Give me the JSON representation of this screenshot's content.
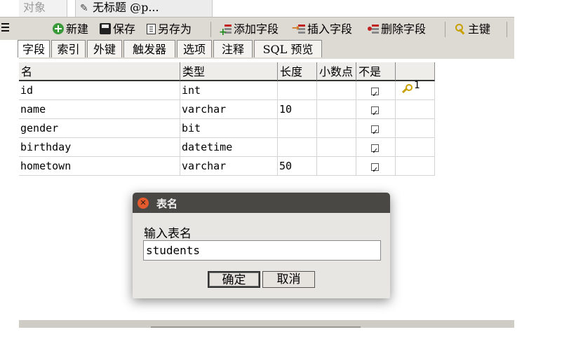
{
  "tabs": {
    "inactive": "对象",
    "active": "无标题 @p..."
  },
  "toolbar": {
    "new": "新建",
    "save": "保存",
    "save_as": "另存为",
    "add_field": "添加字段",
    "insert_field": "插入字段",
    "delete_field": "删除字段",
    "primary_key": "主键"
  },
  "subtabs": [
    "字段",
    "索引",
    "外键",
    "触发器",
    "选项",
    "注释",
    "SQL 预览"
  ],
  "grid": {
    "columns": [
      "名",
      "类型",
      "长度",
      "小数点",
      "不是"
    ],
    "rows": [
      {
        "name": "id",
        "type": "int",
        "length": "",
        "decimal": "",
        "not_null": true,
        "key": "1"
      },
      {
        "name": "name",
        "type": "varchar",
        "length": "10",
        "decimal": "",
        "not_null": true,
        "key": ""
      },
      {
        "name": "gender",
        "type": "bit",
        "length": "",
        "decimal": "",
        "not_null": true,
        "key": ""
      },
      {
        "name": "birthday",
        "type": "datetime",
        "length": "",
        "decimal": "",
        "not_null": true,
        "key": ""
      },
      {
        "name": "hometown",
        "type": "varchar",
        "length": "50",
        "decimal": "",
        "not_null": true,
        "key": ""
      }
    ]
  },
  "dialog": {
    "title": "表名",
    "label": "输入表名",
    "input_value": "students",
    "ok": "确定",
    "cancel": "取消"
  },
  "colors": {
    "toolbar_bg": "#ddd9d3",
    "dialog_title_bg": "#4a4844",
    "close_button": "#e25a2e",
    "key_icon": "#c8a000"
  }
}
